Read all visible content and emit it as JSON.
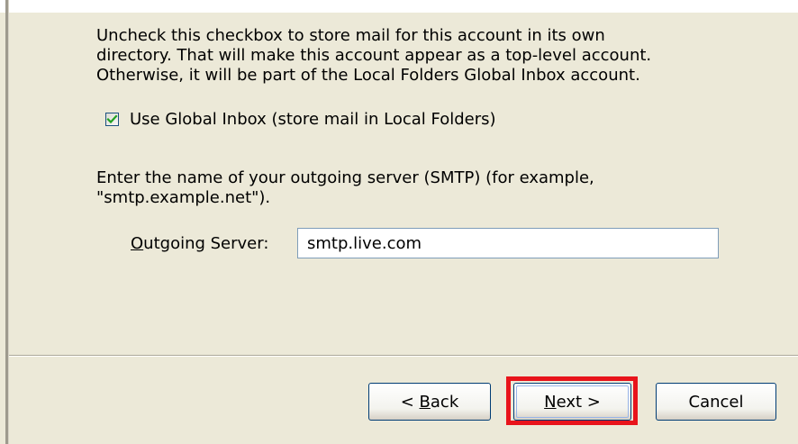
{
  "description": {
    "lines": [
      "Uncheck this checkbox to store mail for this account in its own",
      "directory. That will make this account appear as a top-level account.",
      "Otherwise, it will be part of the Local Folders Global Inbox account."
    ]
  },
  "global_inbox": {
    "checked": true,
    "label": "Use Global Inbox (store mail in Local Folders)"
  },
  "smtp_instructions": {
    "lines": [
      "Enter the name of your outgoing server (SMTP) (for example,",
      "\"smtp.example.net\")."
    ]
  },
  "outgoing_server": {
    "label_prefix": "O",
    "label_rest": "utgoing Server:",
    "value": "smtp.live.com"
  },
  "buttons": {
    "back": {
      "prefix": "< ",
      "mnemonic": "B",
      "rest": "ack"
    },
    "next": {
      "mnemonic": "N",
      "rest": "ext >"
    },
    "cancel": {
      "label": "Cancel"
    }
  },
  "colors": {
    "dialog_bg": "#ece9d8",
    "highlight": "#e8141b",
    "checkmark": "#21a121",
    "input_border": "#7f9db9"
  }
}
